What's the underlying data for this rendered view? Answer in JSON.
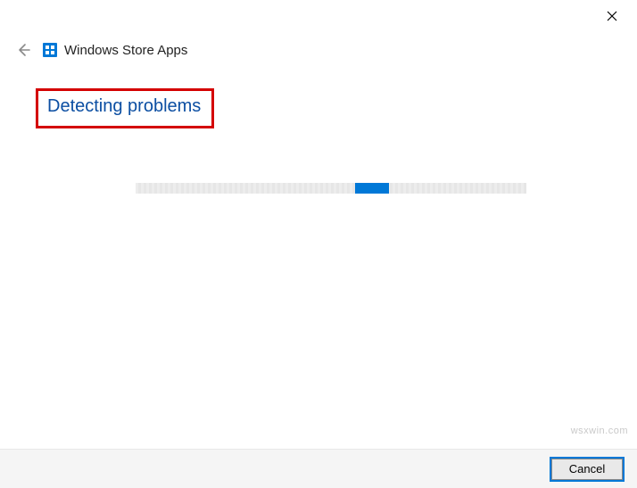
{
  "window": {
    "title": "Windows Store Apps"
  },
  "content": {
    "status": "Detecting problems"
  },
  "footer": {
    "cancel_label": "Cancel"
  },
  "watermark": "wsxwin.com"
}
